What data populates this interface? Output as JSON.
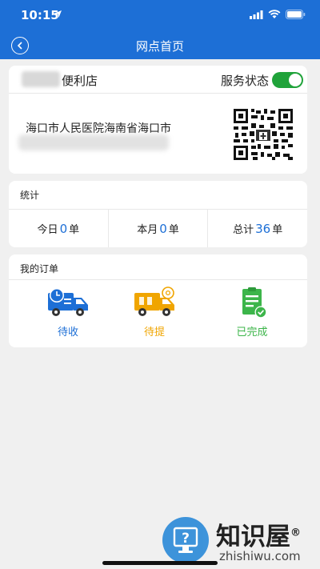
{
  "status_bar": {
    "time": "10:15"
  },
  "nav": {
    "title": "网点首页"
  },
  "store": {
    "name": "便利店",
    "service_label": "服务状态",
    "service_on": true,
    "address": "海口市人民医院海南省海口市"
  },
  "stats": {
    "title": "统计",
    "items": [
      {
        "prefix": "今日",
        "value": "0",
        "suffix": "单"
      },
      {
        "prefix": "本月",
        "value": "0",
        "suffix": "单"
      },
      {
        "prefix": "总计",
        "value": "36",
        "suffix": "单"
      }
    ]
  },
  "orders": {
    "title": "我的订单",
    "items": [
      {
        "label": "待收",
        "color": "#1d6fd6",
        "icon": "truck-clock-icon"
      },
      {
        "label": "待提",
        "color": "#f0a500",
        "icon": "truck-box-icon"
      },
      {
        "label": "已完成",
        "color": "#3cb54a",
        "icon": "clipboard-check-icon"
      }
    ]
  },
  "watermark": {
    "title": "知识屋",
    "url": "zhishiwu.com",
    "registered": "®"
  },
  "colors": {
    "primary": "#1d6fd6",
    "toggle": "#20a33a",
    "background": "#f0f0f0"
  }
}
